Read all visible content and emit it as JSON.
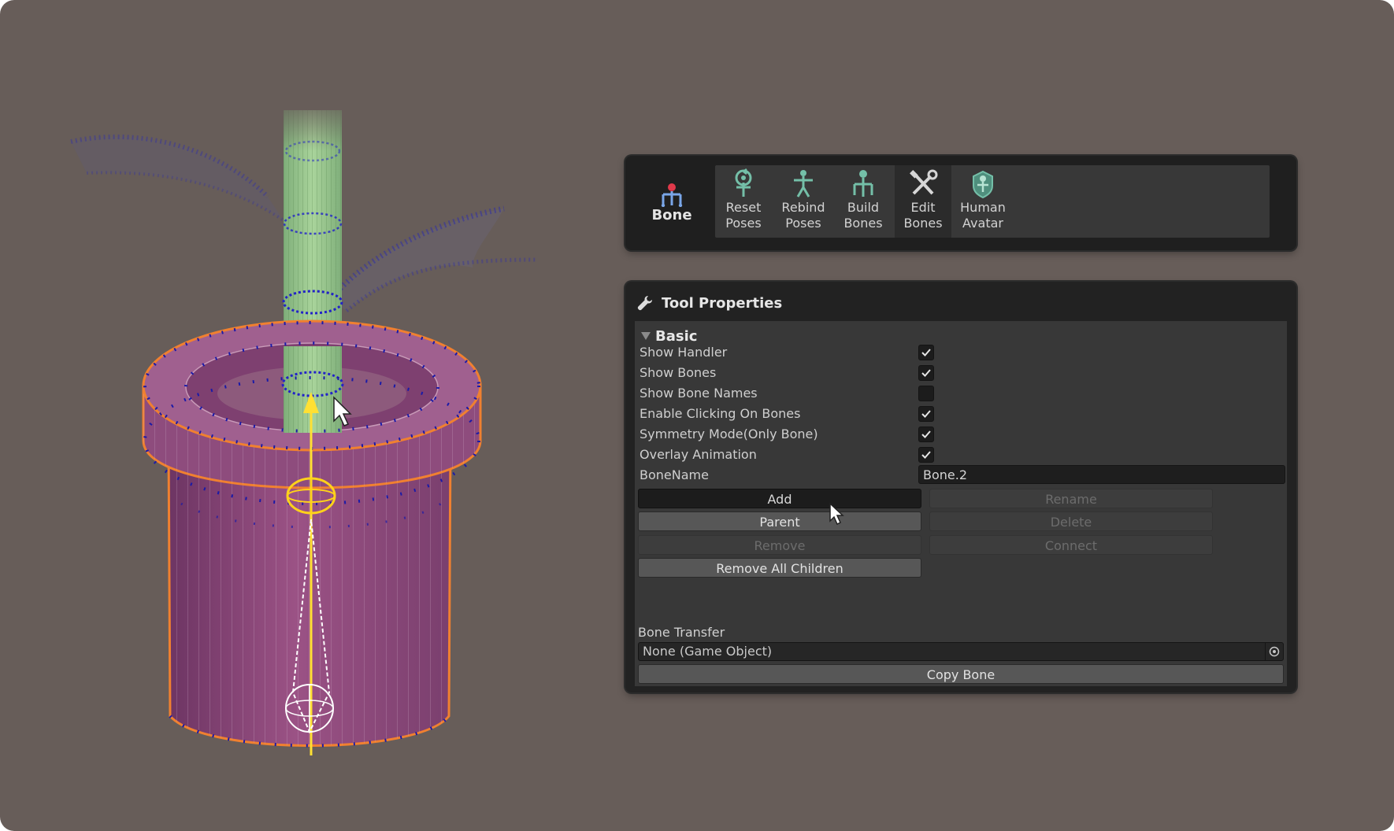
{
  "toolbar": {
    "mode_label": "Bone",
    "tools": [
      {
        "label": "Reset Poses",
        "icon": "reset-poses-icon",
        "active": false
      },
      {
        "label": "Rebind Poses",
        "icon": "rebind-poses-icon",
        "active": false
      },
      {
        "label": "Build Bones",
        "icon": "build-bones-icon",
        "active": false
      },
      {
        "label": "Edit Bones",
        "icon": "edit-bones-icon",
        "active": true
      },
      {
        "label": "Human Avatar",
        "icon": "human-avatar-icon",
        "active": false
      }
    ]
  },
  "panel": {
    "title": "Tool Properties",
    "section": "Basic",
    "options": [
      {
        "label": "Show Handler",
        "checked": true
      },
      {
        "label": "Show Bones",
        "checked": true
      },
      {
        "label": "Show Bone Names",
        "checked": false
      },
      {
        "label": "Enable Clicking On Bones",
        "checked": true
      },
      {
        "label": "Symmetry Mode(Only Bone)",
        "checked": true
      },
      {
        "label": "Overlay Animation",
        "checked": true
      }
    ],
    "bone_name_label": "BoneName",
    "bone_name_value": "Bone.2",
    "buttons": {
      "add": "Add",
      "rename": "Rename",
      "parent": "Parent",
      "delete": "Delete",
      "remove": "Remove",
      "connect": "Connect",
      "remove_all_children": "Remove All Children"
    },
    "bone_transfer_label": "Bone Transfer",
    "bone_transfer_value": "None (Game Object)",
    "copy_bone": "Copy Bone"
  },
  "colors": {
    "background": "#675d59",
    "pot": "#8a4a78",
    "stem": "#8fbf88",
    "selection_outline": "#f08030",
    "vertex": "#1a1aa8",
    "gizmo": "#ffe033"
  }
}
